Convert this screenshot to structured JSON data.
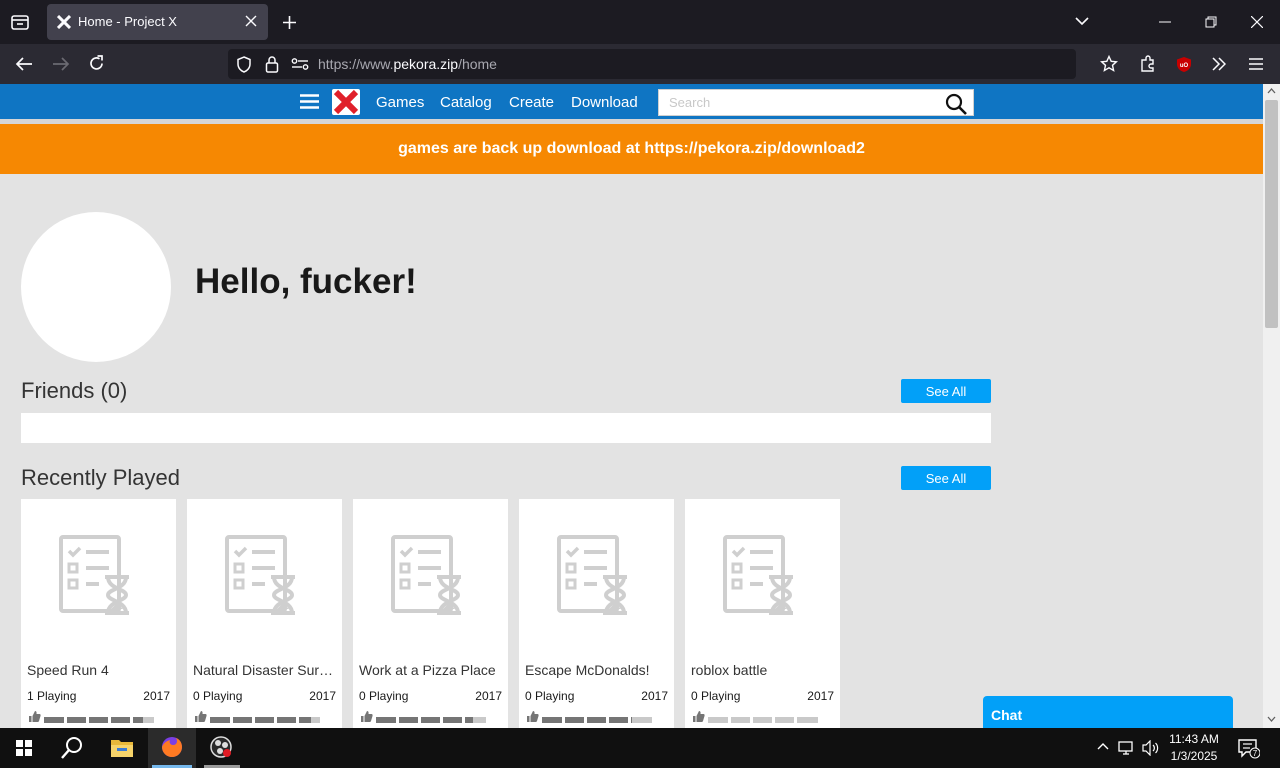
{
  "browser": {
    "tab_title": "Home - Project X",
    "url_prefix": "https://www.",
    "url_domain": "pekora.zip",
    "url_path": "/home"
  },
  "site": {
    "nav": {
      "games": "Games",
      "catalog": "Catalog",
      "create": "Create",
      "download": "Download",
      "search_placeholder": "Search"
    },
    "banner": "games are back up download at https://pekora.zip/download2",
    "greeting": "Hello, fucker!",
    "friends": {
      "title": "Friends (0)",
      "see_all": "See All"
    },
    "recent": {
      "title": "Recently Played",
      "see_all": "See All",
      "games": [
        {
          "name": "Speed Run 4",
          "playing": "1 Playing",
          "year": "2017",
          "vote_fraction": 0.9
        },
        {
          "name": "Natural Disaster Survival",
          "playing": "0 Playing",
          "year": "2017",
          "vote_fraction": 0.92
        },
        {
          "name": "Work at a Pizza Place",
          "playing": "0 Playing",
          "year": "2017",
          "vote_fraction": 0.88
        },
        {
          "name": "Escape McDonalds!",
          "playing": "0 Playing",
          "year": "2017",
          "vote_fraction": 0.82
        },
        {
          "name": "roblox battle",
          "playing": "0 Playing",
          "year": "2017",
          "vote_fraction": 0.0
        }
      ]
    },
    "chat_label": "Chat"
  },
  "taskbar": {
    "time": "11:43 AM",
    "date": "1/3/2025",
    "notifications": "7"
  },
  "icons": {
    "accent_blue": "#0f75c3",
    "banner_orange": "#f68802",
    "button_blue": "#02a0f8"
  }
}
